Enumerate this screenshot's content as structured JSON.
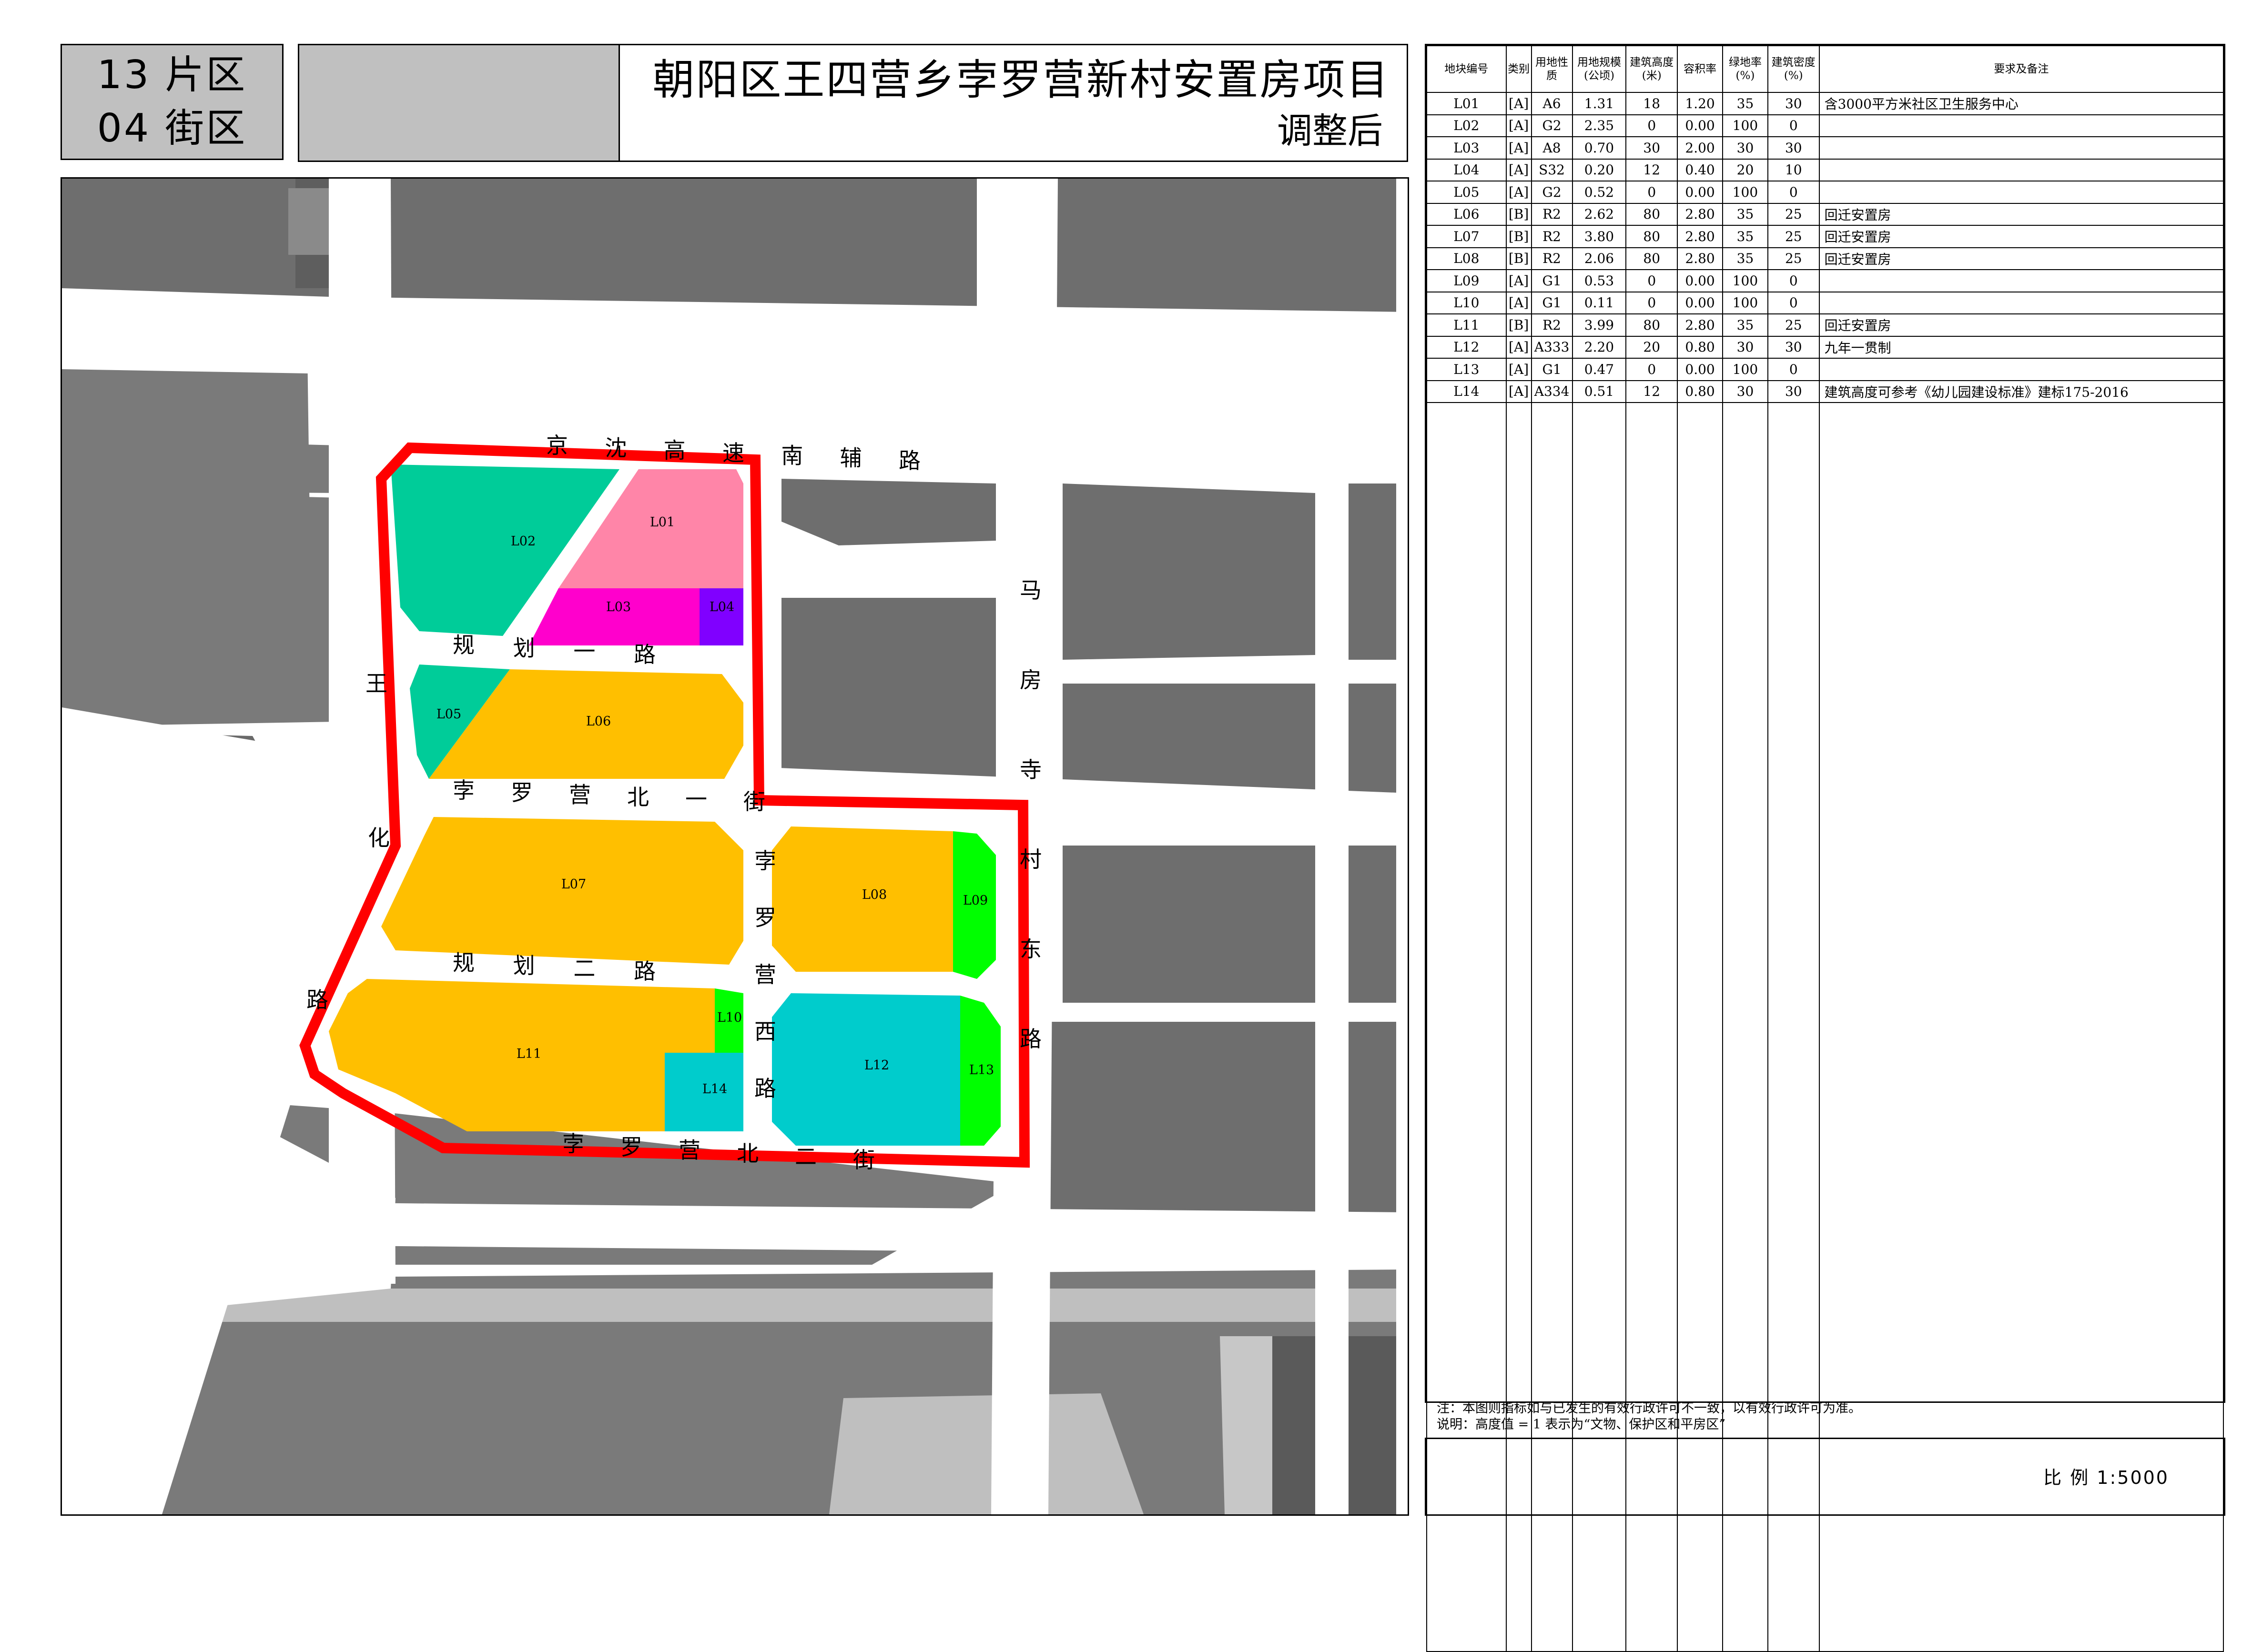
{
  "header": {
    "district_line1": "13 片区",
    "district_line2": "04 街区",
    "title": "朝阳区王四营乡孛罗营新村安置房项目",
    "subtitle": "调整后"
  },
  "table": {
    "headers": [
      "地块编号",
      "类别",
      "用地性质",
      "用地规模(公顷)",
      "建筑高度(米)",
      "容积率",
      "绿地率(%)",
      "建筑密度(%)",
      "要求及备注"
    ],
    "rows": [
      {
        "id": "L01",
        "cls": "[A]",
        "use": "A6",
        "area": "1.31",
        "height": "18",
        "far": "1.20",
        "green": "35",
        "density": "30",
        "note": "含3000平方米社区卫生服务中心"
      },
      {
        "id": "L02",
        "cls": "[A]",
        "use": "G2",
        "area": "2.35",
        "height": "0",
        "far": "0.00",
        "green": "100",
        "density": "0",
        "note": ""
      },
      {
        "id": "L03",
        "cls": "[A]",
        "use": "A8",
        "area": "0.70",
        "height": "30",
        "far": "2.00",
        "green": "30",
        "density": "30",
        "note": ""
      },
      {
        "id": "L04",
        "cls": "[A]",
        "use": "S32",
        "area": "0.20",
        "height": "12",
        "far": "0.40",
        "green": "20",
        "density": "10",
        "note": ""
      },
      {
        "id": "L05",
        "cls": "[A]",
        "use": "G2",
        "area": "0.52",
        "height": "0",
        "far": "0.00",
        "green": "100",
        "density": "0",
        "note": ""
      },
      {
        "id": "L06",
        "cls": "[B]",
        "use": "R2",
        "area": "2.62",
        "height": "80",
        "far": "2.80",
        "green": "35",
        "density": "25",
        "note": " 回迁安置房"
      },
      {
        "id": "L07",
        "cls": "[B]",
        "use": "R2",
        "area": "3.80",
        "height": "80",
        "far": "2.80",
        "green": "35",
        "density": "25",
        "note": " 回迁安置房"
      },
      {
        "id": "L08",
        "cls": "[B]",
        "use": "R2",
        "area": "2.06",
        "height": "80",
        "far": "2.80",
        "green": "35",
        "density": "25",
        "note": " 回迁安置房"
      },
      {
        "id": "L09",
        "cls": "[A]",
        "use": "G1",
        "area": "0.53",
        "height": "0",
        "far": "0.00",
        "green": "100",
        "density": "0",
        "note": ""
      },
      {
        "id": "L10",
        "cls": "[A]",
        "use": "G1",
        "area": "0.11",
        "height": "0",
        "far": "0.00",
        "green": "100",
        "density": "0",
        "note": ""
      },
      {
        "id": "L11",
        "cls": "[B]",
        "use": "R2",
        "area": "3.99",
        "height": "80",
        "far": "2.80",
        "green": "35",
        "density": "25",
        "note": " 回迁安置房"
      },
      {
        "id": "L12",
        "cls": "[A]",
        "use": "A333",
        "area": "2.20",
        "height": "20",
        "far": "0.80",
        "green": "30",
        "density": "30",
        "note": "九年一贯制"
      },
      {
        "id": "L13",
        "cls": "[A]",
        "use": "G1",
        "area": "0.47",
        "height": "0",
        "far": "0.00",
        "green": "100",
        "density": "0",
        "note": ""
      },
      {
        "id": "L14",
        "cls": "[A]",
        "use": "A334",
        "area": "0.51",
        "height": "12",
        "far": "0.80",
        "green": "30",
        "density": "30",
        "note": "建筑高度可参考《幼儿园建设标准》建标175-2016"
      }
    ]
  },
  "notes": {
    "line1": "注：本图则指标如与已发生的有效行政许可不一致，以有效行政许可为准。",
    "line2": "说明：高度值 = 1 表示为“文物、保护区和平房区”"
  },
  "scale": {
    "text": "比  例   1:5000"
  },
  "map": {
    "roads": {
      "north": "京沈高速南辅路",
      "west": "王化路",
      "east": "马房寺村东路",
      "plan1": "规划一路",
      "plan2": "规划二路",
      "north1": "孛罗营北一街",
      "north2": "孛罗营北二街",
      "west_road": "孛罗营西路"
    },
    "parcels": [
      {
        "id": "L01",
        "color": "#ff85a8"
      },
      {
        "id": "L02",
        "color": "#00cc99"
      },
      {
        "id": "L03",
        "color": "#ff00cc"
      },
      {
        "id": "L04",
        "color": "#8000ff"
      },
      {
        "id": "L05",
        "color": "#00cc99"
      },
      {
        "id": "L06",
        "color": "#ffbf00"
      },
      {
        "id": "L07",
        "color": "#ffbf00"
      },
      {
        "id": "L08",
        "color": "#ffbf00"
      },
      {
        "id": "L09",
        "color": "#00ff00"
      },
      {
        "id": "L10",
        "color": "#00ff00"
      },
      {
        "id": "L11",
        "color": "#ffbf00"
      },
      {
        "id": "L12",
        "color": "#00cccc"
      },
      {
        "id": "L13",
        "color": "#00ff00"
      },
      {
        "id": "L14",
        "color": "#00cccc"
      }
    ],
    "boundary_color": "#ff0000"
  }
}
